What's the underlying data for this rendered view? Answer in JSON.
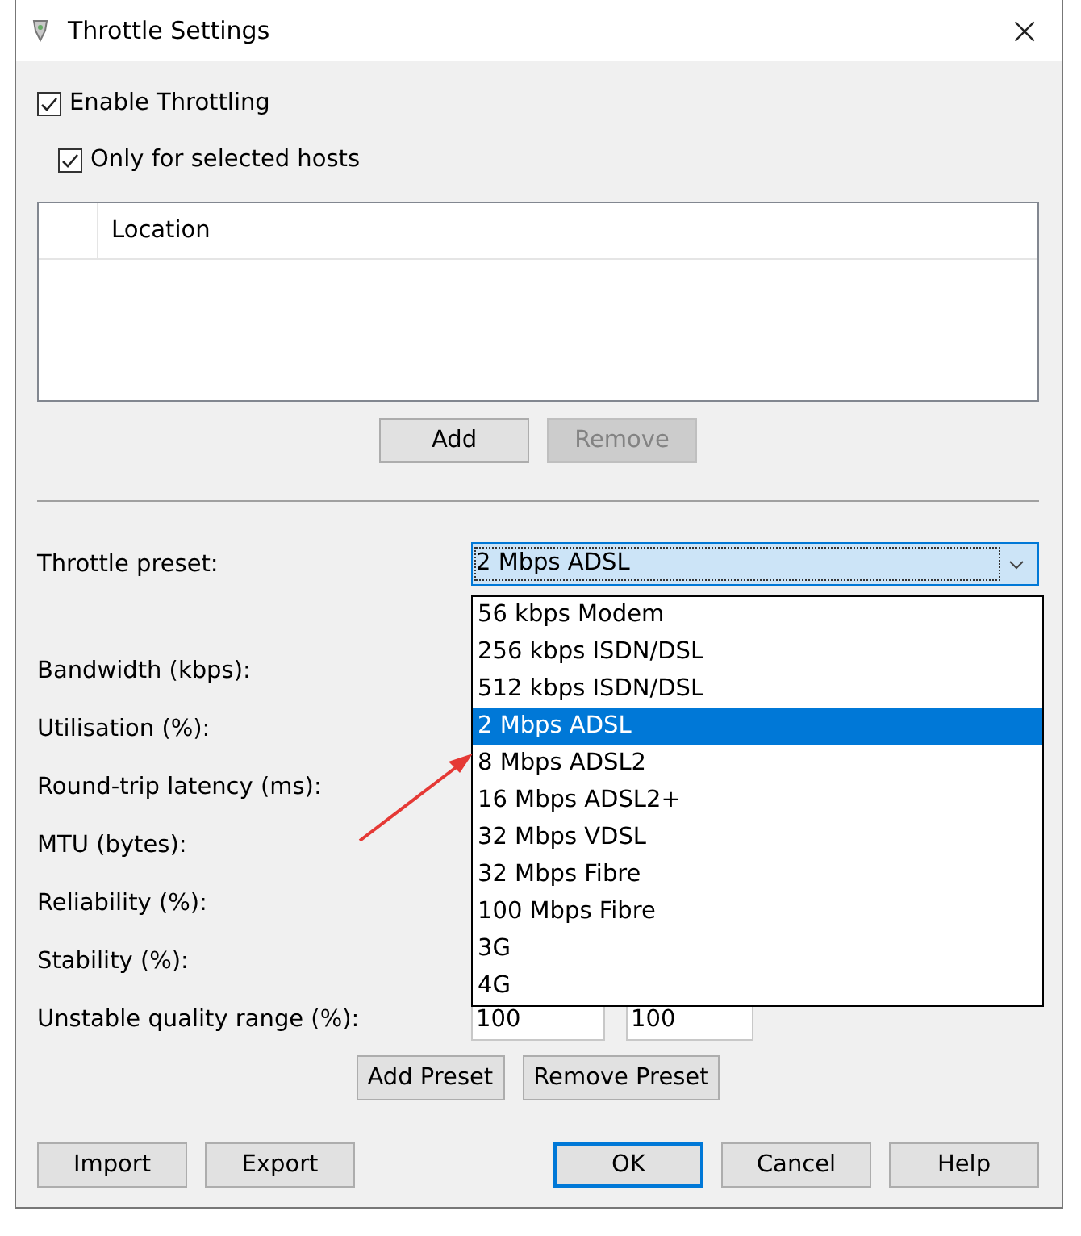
{
  "window": {
    "title": "Throttle Settings",
    "close": "×"
  },
  "checkboxes": [
    {
      "label": "Enable Throttling",
      "checked": true,
      "indented": false
    },
    {
      "label": "Only for selected hosts",
      "checked": true,
      "indented": true
    }
  ],
  "hosts_table": {
    "columns": [
      "Location"
    ]
  },
  "table_buttons": [
    {
      "label": "Add",
      "disabled": false
    },
    {
      "label": "Remove",
      "disabled": true
    }
  ],
  "preset": {
    "label": "Throttle preset:",
    "value": "2 Mbps ADSL",
    "expanded": true,
    "options": [
      {
        "label": "56 kbps Modem",
        "selected": false
      },
      {
        "label": "256 kbps ISDN/DSL",
        "selected": false
      },
      {
        "label": "512 kbps ISDN/DSL",
        "selected": false
      },
      {
        "label": "2 Mbps ADSL",
        "selected": true
      },
      {
        "label": "8 Mbps ADSL2",
        "selected": false
      },
      {
        "label": "16 Mbps ADSL2+",
        "selected": false
      },
      {
        "label": "32 Mbps VDSL",
        "selected": false
      },
      {
        "label": "32 Mbps Fibre",
        "selected": false
      },
      {
        "label": "100 Mbps Fibre",
        "selected": false
      },
      {
        "label": "3G",
        "selected": false
      },
      {
        "label": "4G",
        "selected": false
      }
    ]
  },
  "fields": [
    {
      "label": "Bandwidth (kbps):"
    },
    {
      "label": "Utilisation (%):"
    },
    {
      "label": "Round-trip latency (ms):"
    },
    {
      "label": "MTU (bytes):"
    },
    {
      "label": "Reliability (%):"
    },
    {
      "label": "Stability (%):"
    },
    {
      "label": "Unstable quality range (%):",
      "values": [
        "100",
        "100"
      ]
    }
  ],
  "preset_buttons": [
    "Add Preset",
    "Remove Preset"
  ],
  "footer_left": [
    "Import",
    "Export"
  ],
  "footer_right": [
    {
      "label": "OK",
      "default": true
    },
    {
      "label": "Cancel",
      "default": false
    },
    {
      "label": "Help",
      "default": false
    }
  ]
}
